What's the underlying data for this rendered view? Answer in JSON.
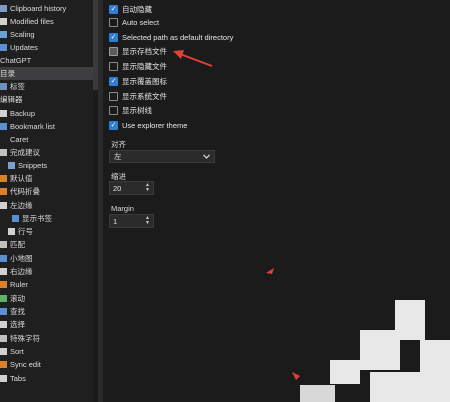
{
  "sidebar": {
    "items": [
      {
        "label": "Clipboard history",
        "icon": "clipboard-icon",
        "color": "#7a9cc6"
      },
      {
        "label": "Modified files",
        "icon": "file-icon",
        "color": "#d0d0d0"
      },
      {
        "label": "Scaling",
        "icon": "scaling-icon",
        "color": "#6aa0d8"
      },
      {
        "label": "Updates",
        "icon": "updates-icon",
        "color": "#5b8fd0"
      },
      {
        "label": "ChatGPT",
        "icon": "",
        "color": ""
      },
      {
        "label": "目录",
        "icon": "",
        "color": ""
      },
      {
        "label": "标签",
        "icon": "tag-icon",
        "color": "#6f8fc0"
      },
      {
        "label": "编辑器",
        "icon": "",
        "color": ""
      },
      {
        "label": "Backup",
        "icon": "backup-icon",
        "color": "#d0d0d0"
      },
      {
        "label": "Bookmark list",
        "icon": "bookmark-icon",
        "color": "#5b8fd0"
      },
      {
        "label": "Caret",
        "icon": "",
        "color": ""
      },
      {
        "label": "完成建议",
        "icon": "completion-icon",
        "color": "#c0c0c0"
      },
      {
        "label": "Snippets",
        "icon": "snippet-icon",
        "color": "#7aa0c8"
      },
      {
        "label": "默认值",
        "icon": "defaults-icon",
        "color": "#d9822b"
      },
      {
        "label": "代码折叠",
        "icon": "fold-icon",
        "color": "#d9822b"
      },
      {
        "label": "左边缘",
        "icon": "left-margin-icon",
        "color": "#d0d0d0"
      },
      {
        "label": "显示书签",
        "icon": "show-bookmark-icon",
        "color": "#5b8fd0"
      },
      {
        "label": "行号",
        "icon": "line-number-icon",
        "color": "#d0d0d0"
      },
      {
        "label": "匹配",
        "icon": "match-icon",
        "color": "#c0c0c0"
      },
      {
        "label": "小地图",
        "icon": "minimap-icon",
        "color": "#5b8fd0"
      },
      {
        "label": "右边缘",
        "icon": "right-margin-icon",
        "color": "#d0d0d0"
      },
      {
        "label": "Ruler",
        "icon": "ruler-icon",
        "color": "#d9822b"
      },
      {
        "label": "滚动",
        "icon": "scroll-icon",
        "color": "#5fb06a"
      },
      {
        "label": "查找",
        "icon": "search-icon",
        "color": "#5b8fd0"
      },
      {
        "label": "选择",
        "icon": "selection-icon",
        "color": "#d0d0d0"
      },
      {
        "label": "特殊字符",
        "icon": "special-chars-icon",
        "color": "#c0c0c0"
      },
      {
        "label": "Sort",
        "icon": "sort-icon",
        "color": "#d0d0d0"
      },
      {
        "label": "Sync edit",
        "icon": "sync-edit-icon",
        "color": "#d9822b"
      },
      {
        "label": "Tabs",
        "icon": "tabs-icon",
        "color": "#d0d0d0"
      }
    ]
  },
  "options": [
    {
      "label": "自动隐藏",
      "checked": true,
      "highlight": false
    },
    {
      "label": "Auto select",
      "checked": false,
      "highlight": false
    },
    {
      "label": "Selected path as default directory",
      "checked": true,
      "highlight": false
    },
    {
      "label": "显示存档文件",
      "checked": false,
      "highlight": true
    },
    {
      "label": "显示隐藏文件",
      "checked": false,
      "highlight": false
    },
    {
      "label": "显示覆盖图标",
      "checked": true,
      "highlight": false
    },
    {
      "label": "显示系统文件",
      "checked": false,
      "highlight": false
    },
    {
      "label": "显示树线",
      "checked": false,
      "highlight": false
    },
    {
      "label": "Use explorer theme",
      "checked": true,
      "highlight": false
    }
  ],
  "align": {
    "label": "对齐",
    "value": "左"
  },
  "indent": {
    "label": "缩进",
    "value": "20"
  },
  "margin": {
    "label": "Margin",
    "value": "1"
  },
  "colors": {
    "accent": "#2d7fd4",
    "arrow": "#e0403a",
    "selected_bg": "#3e3e40"
  }
}
